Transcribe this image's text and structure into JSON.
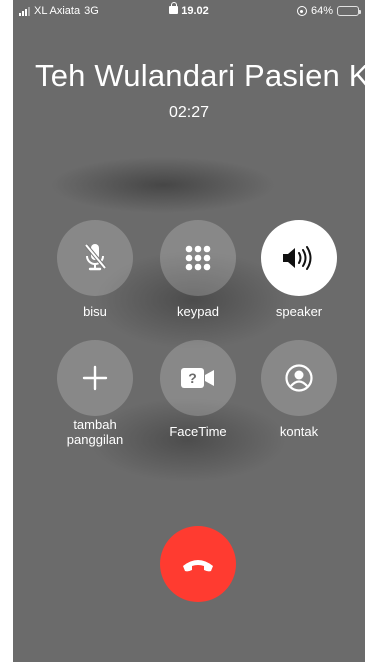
{
  "status_bar": {
    "carrier": "XL Axiata",
    "network": "3G",
    "time": "19.02",
    "battery": "64%",
    "battery_level": 0.64
  },
  "call": {
    "caller_name": "Teh Wulandari Pasien Ko",
    "duration": "02:27"
  },
  "controls": {
    "mute_label": "bisu",
    "keypad_label": "keypad",
    "speaker_label": "speaker",
    "add_call_line1": "tambah",
    "add_call_line2": "panggilan",
    "facetime_label": "FaceTime",
    "contacts_label": "kontak"
  },
  "colors": {
    "background": "#6b6b6b",
    "end_call": "#ff3b30",
    "battery_fill": "#ffd60a"
  }
}
